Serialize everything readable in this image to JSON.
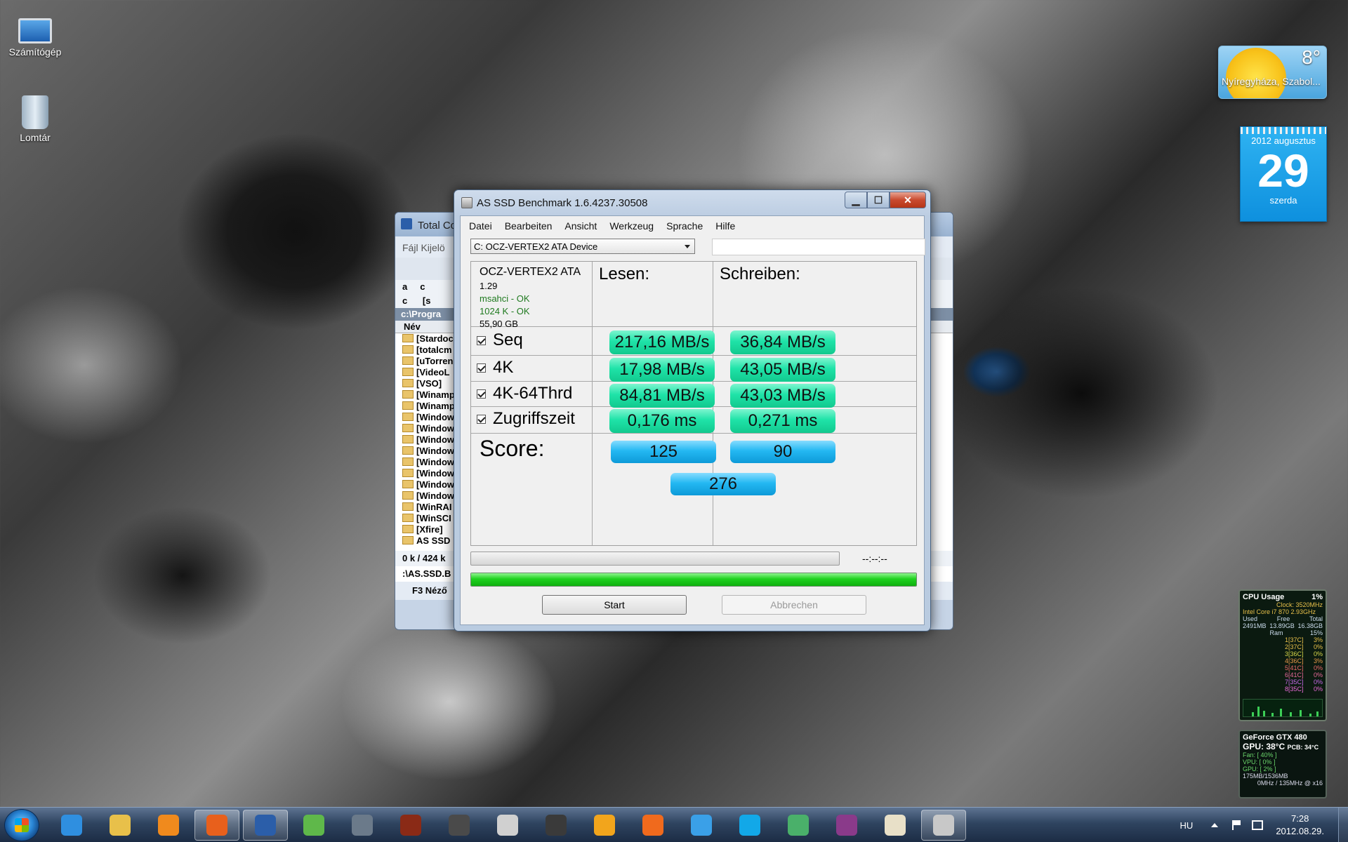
{
  "desktop": {
    "icons": [
      {
        "label": "Számítógép"
      },
      {
        "label": "Lomtár"
      }
    ]
  },
  "weather": {
    "temp": "8°",
    "city": "Nyíregyháza, Szabol..."
  },
  "calendar": {
    "month": "2012 augusztus",
    "day": "29",
    "weekday": "szerda"
  },
  "cpu_gadget": {
    "title": "CPU Usage",
    "usage": "1%",
    "clock": "Clock: 3520MHz",
    "cpu": "Intel Core i7 870 2.93GHz",
    "mem_headers": [
      "Used",
      "Free",
      "Total"
    ],
    "mem_values": [
      "2491MB",
      "13.89GB",
      "16.38GB"
    ],
    "ram_label": "Ram",
    "ram_pct": "15%",
    "cores": [
      {
        "core": "1[37C]",
        "pct": "3%"
      },
      {
        "core": "2[37C]",
        "pct": "0%"
      },
      {
        "core": "3[36C]",
        "pct": "0%"
      },
      {
        "core": "4[36C]",
        "pct": "3%"
      },
      {
        "core": "5[41C]",
        "pct": "0%"
      },
      {
        "core": "6[41C]",
        "pct": "0%"
      },
      {
        "core": "7[35C]",
        "pct": "0%"
      },
      {
        "core": "8[35C]",
        "pct": "0%"
      }
    ]
  },
  "gpu_gadget": {
    "title": "GeForce GTX 480",
    "gpu_temp": "GPU: 38°C",
    "pcb_temp": "PCB: 34°C",
    "fan": "Fan: [ 40% ]",
    "vpu": "VPU: [ 0% ]",
    "gpu": "GPU: [ 2% ]",
    "mem": "175MB/1536MB",
    "clock": "0MHz / 135MHz @ x16"
  },
  "total_commander": {
    "title": "Total Co",
    "menu": "Fájl  Kijelö",
    "drive_a": "a",
    "drive_c": "c",
    "drive_sel": "c",
    "drive_info": "[s",
    "path": "c:\\Progra",
    "col_name": "Név",
    "files": [
      "[Stardoc",
      "[totalcm",
      "[uTorren",
      "[VideoL",
      "[VSO]",
      "[Winamp",
      "[Winamp",
      "[Window",
      "[Window",
      "[Window",
      "[Window",
      "[Window",
      "[Window",
      "[Window",
      "[Window",
      "[WinRAI",
      "[WinSCI",
      "[Xfire]",
      "AS SSD"
    ],
    "status": "0 k / 424 k",
    "cmdline": ":\\AS.SSD.B",
    "fkeys": "F3 Néző"
  },
  "window": {
    "title": "AS SSD Benchmark 1.6.4237.30508",
    "controls": {
      "minimize": "▁",
      "maximize": "☐",
      "close": "✕"
    }
  },
  "menu": [
    "Datei",
    "Bearbeiten",
    "Ansicht",
    "Werkzeug",
    "Sprache",
    "Hilfe"
  ],
  "device_select": {
    "value": "C: OCZ-VERTEX2 ATA Device"
  },
  "device_info": {
    "name": "OCZ-VERTEX2 ATA",
    "firmware": "1.29",
    "driver": "msahci - OK",
    "alignment": "1024 K - OK",
    "size": "55,90 GB"
  },
  "headers": {
    "read": "Lesen:",
    "write": "Schreiben:"
  },
  "results": [
    {
      "label": "Seq",
      "checked": true,
      "read": "217,16 MB/s",
      "write": "36,84 MB/s"
    },
    {
      "label": "4K",
      "checked": true,
      "read": "17,98 MB/s",
      "write": "43,05 MB/s"
    },
    {
      "label": "4K-64Thrd",
      "checked": true,
      "read": "84,81 MB/s",
      "write": "43,03 MB/s"
    },
    {
      "label": "Zugriffszeit",
      "checked": true,
      "read": "0,176 ms",
      "write": "0,271 ms"
    }
  ],
  "score": {
    "label": "Score:",
    "read": "125",
    "write": "90",
    "total": "276"
  },
  "progress": {
    "timer": "--:--:--",
    "overall_fraction": 1.0
  },
  "buttons": {
    "start": "Start",
    "cancel": "Abbrechen"
  },
  "taskbar": {
    "apps": [
      {
        "name": "internet-explorer",
        "color": "#2f8fe0",
        "active": false
      },
      {
        "name": "explorer",
        "color": "#e8c04a",
        "active": false
      },
      {
        "name": "media-player",
        "color": "#f08a1d",
        "active": false
      },
      {
        "name": "firefox",
        "color": "#e8601c",
        "active": true
      },
      {
        "name": "total-commander",
        "color": "#2b5ea9",
        "active": true
      },
      {
        "name": "xbox-app",
        "color": "#5fb84a",
        "active": false
      },
      {
        "name": "game-1",
        "color": "#6b7a8a",
        "active": false
      },
      {
        "name": "diablo",
        "color": "#8a2a16",
        "active": false
      },
      {
        "name": "game-2",
        "color": "#4a4a4a",
        "active": false
      },
      {
        "name": "gta-iv",
        "color": "#d0d0d0",
        "active": false
      },
      {
        "name": "game-3",
        "color": "#3a3a3a",
        "active": false
      },
      {
        "name": "winamp",
        "color": "#f2a51c",
        "active": false
      },
      {
        "name": "origin",
        "color": "#f06a1d",
        "active": false
      },
      {
        "name": "itunes",
        "color": "#3aa0e8",
        "active": false
      },
      {
        "name": "skype",
        "color": "#12a8e8",
        "active": false
      },
      {
        "name": "messenger",
        "color": "#4ab06a",
        "active": false
      },
      {
        "name": "winrar",
        "color": "#8a3a8a",
        "active": false
      },
      {
        "name": "paint",
        "color": "#e8e0c8",
        "active": false
      },
      {
        "name": "as-ssd",
        "color": "#c8c8c8",
        "active": true
      }
    ],
    "lang": "HU",
    "time": "7:28",
    "date": "2012.08.29."
  }
}
